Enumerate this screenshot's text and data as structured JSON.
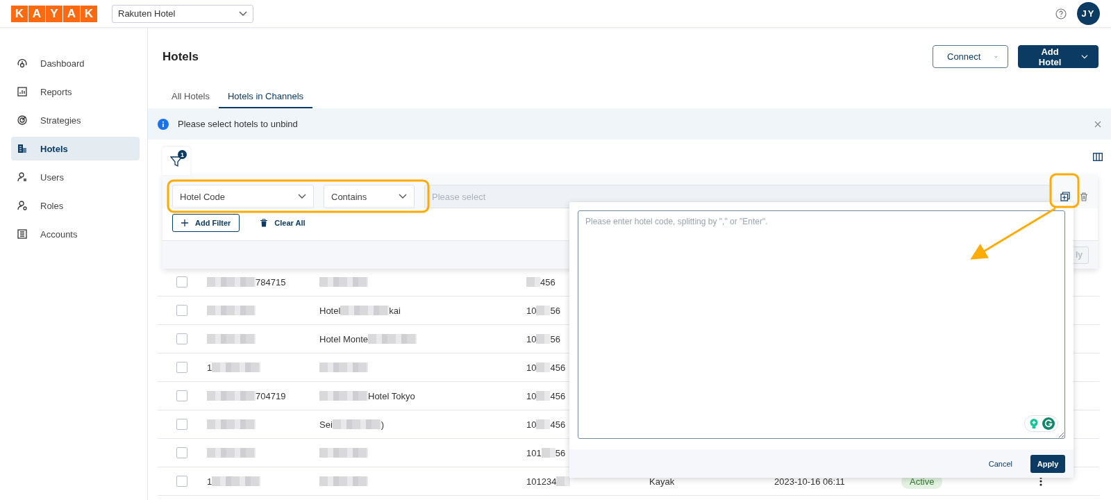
{
  "header": {
    "logo_letters": [
      "K",
      "A",
      "Y",
      "A",
      "K"
    ],
    "property_select": "Rakuten Hotel",
    "avatar": "JY"
  },
  "sidebar": {
    "items": [
      {
        "label": "Dashboard",
        "kind": "gauge",
        "selected": false
      },
      {
        "label": "Reports",
        "kind": "chart",
        "selected": false
      },
      {
        "label": "Strategies",
        "kind": "target",
        "selected": false
      },
      {
        "label": "Hotels",
        "kind": "building",
        "selected": true
      },
      {
        "label": "Users",
        "kind": "user",
        "selected": false
      },
      {
        "label": "Roles",
        "kind": "role",
        "selected": false
      },
      {
        "label": "Accounts",
        "kind": "ledger",
        "selected": false
      }
    ]
  },
  "page": {
    "title": "Hotels",
    "buttons": [
      {
        "label": "Connect",
        "kind": "outline"
      },
      {
        "label": "Add Hotel",
        "kind": "primary"
      }
    ]
  },
  "tabs": [
    {
      "label": "All Hotels",
      "selected": false
    },
    {
      "label": "Hotels in Channels",
      "selected": true
    }
  ],
  "notice": {
    "text": "Please select hotels to unbind"
  },
  "filter": {
    "badge": "1",
    "field": "Hotel Code",
    "operator": "Contains",
    "value_placeholder": "Please select",
    "add_button": "Add Filter",
    "clear_button": "Clear All",
    "apply_button": {
      "label": "ly",
      "disabled": true
    }
  },
  "popup": {
    "placeholder": "Please enter hotel code, splitting by \",\" or \"Enter\".",
    "cancel": "Cancel",
    "apply": "Apply"
  },
  "table": {
    "rows": [
      {
        "checked": false,
        "cells": [
          [
            {
              "kind": "blur"
            },
            {
              "kind": "text",
              "text": "784715"
            }
          ],
          [
            {
              "kind": "blur"
            }
          ],
          [
            {
              "kind": "blur"
            },
            {
              "kind": "text",
              "text": "456"
            }
          ]
        ]
      },
      {
        "checked": false,
        "cells": [
          [
            {
              "kind": "blur"
            }
          ],
          [
            {
              "kind": "text",
              "text": "Hotel"
            },
            {
              "kind": "blur"
            },
            {
              "kind": "text",
              "text": "kai"
            }
          ],
          [
            {
              "kind": "text",
              "text": "10"
            },
            {
              "kind": "blur"
            },
            {
              "kind": "text",
              "text": "56"
            }
          ]
        ]
      },
      {
        "checked": false,
        "cells": [
          [
            {
              "kind": "blur"
            }
          ],
          [
            {
              "kind": "text",
              "text": "Hotel Monte"
            },
            {
              "kind": "blur"
            }
          ],
          [
            {
              "kind": "text",
              "text": "10"
            },
            {
              "kind": "blur"
            },
            {
              "kind": "text",
              "text": "56"
            }
          ]
        ]
      },
      {
        "checked": false,
        "cells": [
          [
            {
              "kind": "text",
              "text": "1"
            },
            {
              "kind": "blur"
            }
          ],
          [
            {
              "kind": "blur"
            }
          ],
          [
            {
              "kind": "text",
              "text": "10"
            },
            {
              "kind": "blur"
            },
            {
              "kind": "text",
              "text": "456"
            }
          ]
        ]
      },
      {
        "checked": false,
        "cells": [
          [
            {
              "kind": "blur"
            },
            {
              "kind": "text",
              "text": "704719"
            }
          ],
          [
            {
              "kind": "blur"
            },
            {
              "kind": "text",
              "text": "Hotel Tokyo"
            }
          ],
          [
            {
              "kind": "text",
              "text": "10"
            },
            {
              "kind": "blur"
            },
            {
              "kind": "text",
              "text": "456"
            }
          ]
        ]
      },
      {
        "checked": false,
        "cells": [
          [
            {
              "kind": "blur"
            }
          ],
          [
            {
              "kind": "text",
              "text": "Sei"
            },
            {
              "kind": "blur"
            },
            {
              "kind": "text",
              "text": ")"
            }
          ],
          [
            {
              "kind": "text",
              "text": "10"
            },
            {
              "kind": "blur"
            },
            {
              "kind": "text",
              "text": "456"
            }
          ]
        ]
      },
      {
        "checked": false,
        "cells": [
          [
            {
              "kind": "blur"
            }
          ],
          [
            {
              "kind": "blur"
            }
          ],
          [
            {
              "kind": "text",
              "text": "101"
            },
            {
              "kind": "blur"
            },
            {
              "kind": "text",
              "text": "56"
            }
          ]
        ]
      },
      {
        "checked": false,
        "cells": [
          [
            {
              "kind": "text",
              "text": "1"
            },
            {
              "kind": "blur"
            }
          ],
          [
            {
              "kind": "blur"
            }
          ],
          [
            {
              "kind": "text",
              "text": "101234"
            },
            {
              "kind": "blur"
            }
          ]
        ],
        "channel": "Kayak",
        "updated": "2023-10-16 06:11",
        "status": "Active"
      }
    ]
  }
}
